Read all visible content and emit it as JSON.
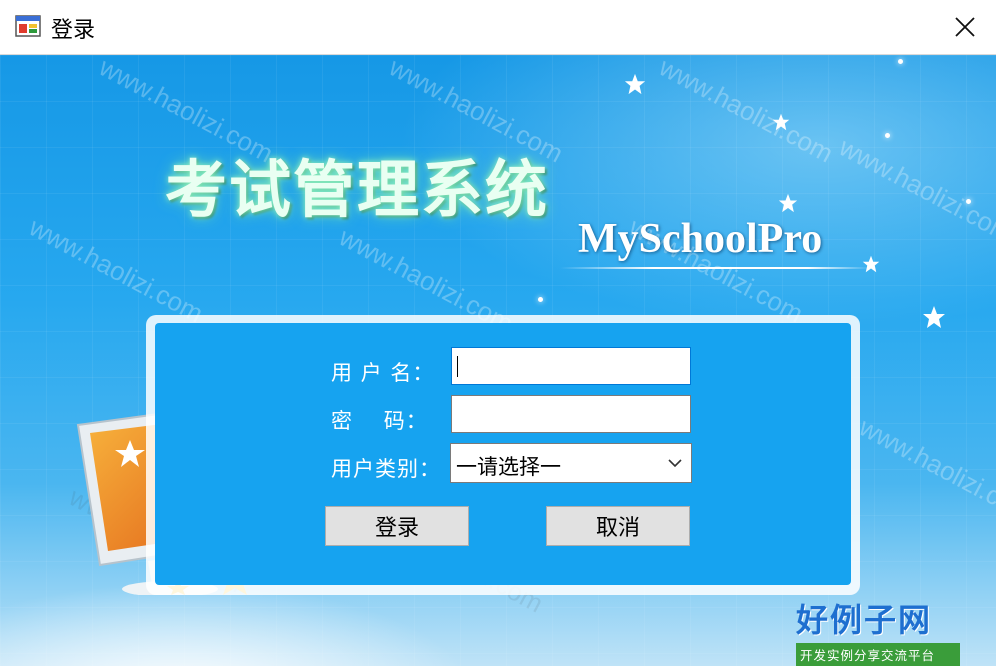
{
  "window": {
    "title": "登录"
  },
  "header": {
    "system_title": "考试管理系统",
    "brand": "MySchoolPro"
  },
  "form": {
    "username_label": "用 户 名：",
    "password_label": "密    码：",
    "usertype_label": "用户类别：",
    "username_value": "",
    "password_value": "",
    "usertype_selected": "一请选择一",
    "login_button": "登录",
    "cancel_button": "取消"
  },
  "watermark": {
    "text": "www.haolizi.com"
  },
  "logo": {
    "main": "好例子网",
    "sub": "开发实例分享交流平台"
  },
  "colors": {
    "panel": "#16a3f0",
    "background_top": "#1698e6",
    "title_glow": "#8ff0c4"
  }
}
